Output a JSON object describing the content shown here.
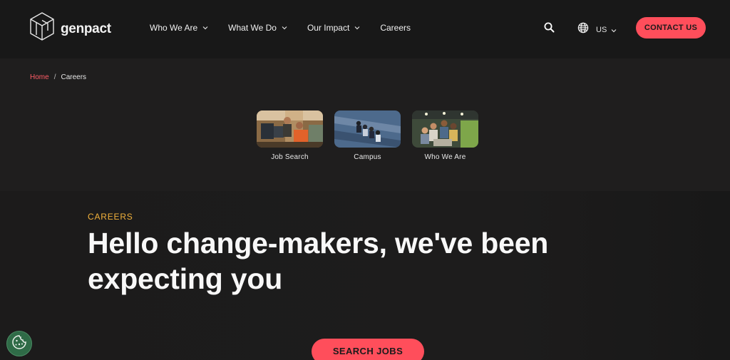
{
  "brand": {
    "name": "genpact"
  },
  "nav": {
    "items": [
      {
        "label": "Who We Are",
        "has_dropdown": true
      },
      {
        "label": "What We Do",
        "has_dropdown": true
      },
      {
        "label": "Our Impact",
        "has_dropdown": true
      },
      {
        "label": "Careers",
        "has_dropdown": false
      }
    ],
    "region": "US",
    "contact_label": "CONTACT US"
  },
  "breadcrumb": {
    "home": "Home",
    "separator": "/",
    "current": "Careers"
  },
  "cards": [
    {
      "label": "Job Search"
    },
    {
      "label": "Campus"
    },
    {
      "label": "Who We Are"
    }
  ],
  "hero": {
    "eyebrow": "CAREERS",
    "headline": "Hello change-makers, we've been expecting you",
    "cta_label": "SEARCH JOBS"
  },
  "colors": {
    "background": "#1b1b1b",
    "accent": "#ff4e5b",
    "eyebrow": "#f3b23b",
    "cookie": "#2f6b47"
  },
  "icons": {
    "logo": "genpact-cube-logo-icon",
    "search": "search-icon",
    "globe": "globe-icon",
    "chevron": "chevron-down-icon",
    "cookie": "cookie-icon"
  }
}
